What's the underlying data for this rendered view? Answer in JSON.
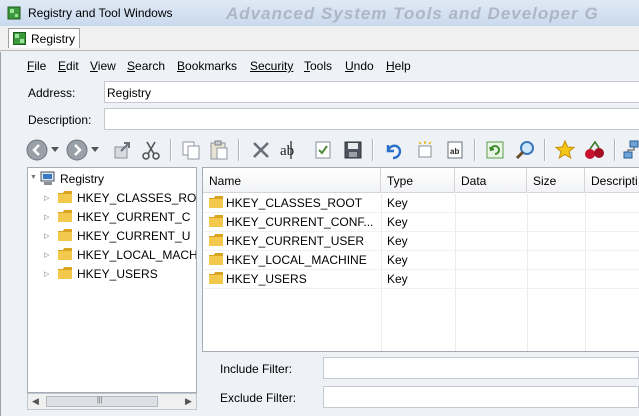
{
  "window": {
    "title": "Registry and Tool Windows",
    "watermark": "Advanced System Tools and Developer G"
  },
  "tab": {
    "label": "Registry"
  },
  "menu": {
    "items": [
      {
        "label": "File",
        "accel": "F",
        "rest": "ile"
      },
      {
        "label": "Edit",
        "accel": "E",
        "rest": "dit"
      },
      {
        "label": "View",
        "accel": "V",
        "rest": "iew"
      },
      {
        "label": "Search",
        "accel": "S",
        "rest": "earch"
      },
      {
        "label": "Bookmarks",
        "accel": "B",
        "rest": "ookmarks"
      },
      {
        "label": "Security",
        "accel": "",
        "rest": "Security"
      },
      {
        "label": "Tools",
        "accel": "T",
        "rest": "ools"
      },
      {
        "label": "Undo",
        "accel": "U",
        "rest": "ndo"
      },
      {
        "label": "Help",
        "accel": "H",
        "rest": "elp"
      }
    ]
  },
  "address": {
    "label": "Address:",
    "value": "Registry"
  },
  "description": {
    "label": "Description:",
    "value": ""
  },
  "toolbar": {
    "buttons": [
      "back-icon",
      "dropdown-icon",
      "forward-icon",
      "dropdown-icon",
      "jump-icon",
      "cut-icon",
      "copy-icon",
      "paste-icon",
      "delete-icon",
      "rename-icon",
      "properties-icon",
      "save-icon",
      "undo-icon",
      "new-key-icon",
      "new-value-icon",
      "refresh-icon",
      "find-icon",
      "bookmark-star-icon",
      "cherries-icon",
      "network-icon"
    ]
  },
  "tree": {
    "root": "Registry",
    "nodes": [
      "HKEY_CLASSES_ROOT",
      "HKEY_CURRENT_CONFIG",
      "HKEY_CURRENT_USER",
      "HKEY_LOCAL_MACHINE",
      "HKEY_USERS"
    ],
    "visible_labels": [
      "HKEY_CLASSES_RO",
      "HKEY_CURRENT_C",
      "HKEY_CURRENT_U",
      "HKEY_LOCAL_MACH",
      "HKEY_USERS"
    ]
  },
  "list": {
    "columns": [
      "Name",
      "Type",
      "Data",
      "Size",
      "Descripti"
    ],
    "rows": [
      {
        "name": "HKEY_CLASSES_ROOT",
        "type": "Key"
      },
      {
        "name": "HKEY_CURRENT_CONF...",
        "type": "Key"
      },
      {
        "name": "HKEY_CURRENT_USER",
        "type": "Key"
      },
      {
        "name": "HKEY_LOCAL_MACHINE",
        "type": "Key"
      },
      {
        "name": "HKEY_USERS",
        "type": "Key"
      }
    ]
  },
  "filters": {
    "include_label": "Include Filter:",
    "exclude_label": "Exclude Filter:",
    "include_value": "",
    "exclude_value": ""
  },
  "colors": {
    "folder": "#f2c94c",
    "folder_dark": "#d9a520",
    "accent_blue": "#2a6fc9"
  }
}
